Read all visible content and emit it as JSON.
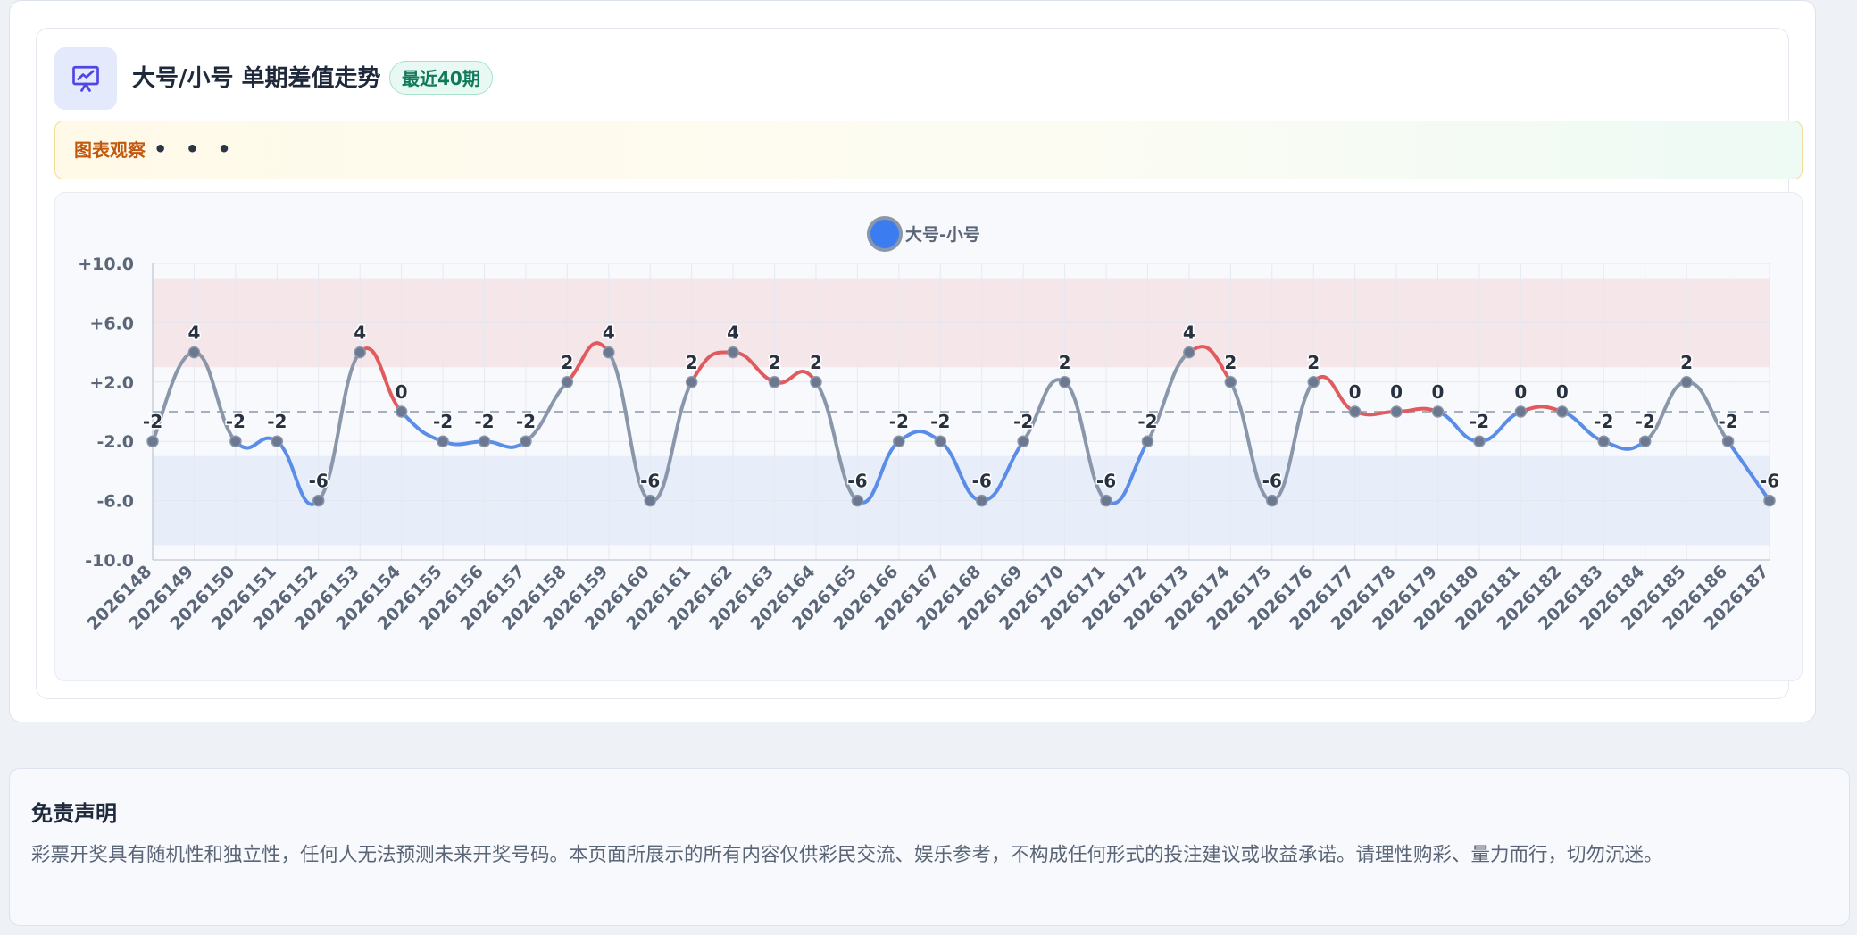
{
  "card": {
    "title": "大号/小号 单期差值走势",
    "badge": "最近40期",
    "icon": "presentation-chart-icon"
  },
  "insight": {
    "label": "图表观察",
    "dots": "• • •"
  },
  "disclaimer": {
    "title": "免责声明",
    "text": "彩票开奖具有随机性和独立性，任何人无法预测未来开奖号码。本页面所展示的所有内容仅供彩民交流、娱乐参考，不构成任何形式的投注建议或收益承诺。请理性购彩、量力而行，切勿沉迷。"
  },
  "colors": {
    "positive": "#e05a5e",
    "negative": "#5a8de8",
    "neutral_line": "#8a97aa",
    "legend_dot": "#3b7df0",
    "high_band": "#f5e6ea",
    "low_band": "#e7eefa",
    "accent": "#4f46e5"
  },
  "chart_data": {
    "type": "line",
    "legend": [
      "大号-小号"
    ],
    "legend_placement": "top-center",
    "x": [
      "2026148",
      "2026149",
      "2026150",
      "2026151",
      "2026152",
      "2026153",
      "2026154",
      "2026155",
      "2026156",
      "2026157",
      "2026158",
      "2026159",
      "2026160",
      "2026161",
      "2026162",
      "2026163",
      "2026164",
      "2026165",
      "2026166",
      "2026167",
      "2026168",
      "2026169",
      "2026170",
      "2026171",
      "2026172",
      "2026173",
      "2026174",
      "2026175",
      "2026176",
      "2026177",
      "2026178",
      "2026179",
      "2026180",
      "2026181",
      "2026182",
      "2026183",
      "2026184",
      "2026185",
      "2026186",
      "2026187"
    ],
    "series": [
      {
        "name": "大号-小号",
        "values": [
          -2,
          4,
          -2,
          -2,
          -6,
          4,
          0,
          -2,
          -2,
          -2,
          2,
          4,
          -6,
          2,
          4,
          2,
          2,
          -6,
          -2,
          -2,
          -6,
          -2,
          2,
          -6,
          -2,
          4,
          2,
          -6,
          2,
          0,
          0,
          0,
          -2,
          0,
          0,
          -2,
          -2,
          2,
          -2,
          -6
        ]
      }
    ],
    "ylim": [
      -10,
      10
    ],
    "yticks": [
      "+10.0",
      "+6.0",
      "+2.0",
      "-2.0",
      "-6.0",
      "-10.0"
    ],
    "reference_line": 0,
    "bands": [
      {
        "from": 3,
        "to": 9,
        "kind": "high"
      },
      {
        "from": -9,
        "to": -3,
        "kind": "low"
      }
    ],
    "grid": true,
    "xlabel": "",
    "ylabel": ""
  }
}
